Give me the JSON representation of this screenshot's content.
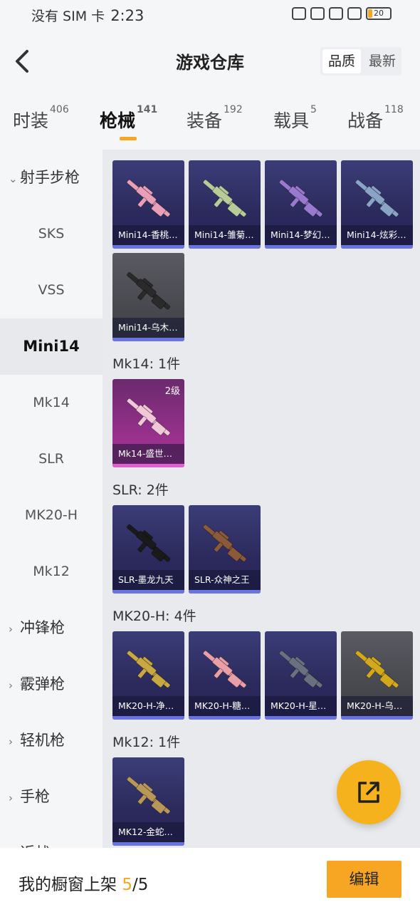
{
  "status_bar": {
    "carrier": "没有 SIM 卡",
    "time": "2:23",
    "battery": "20"
  },
  "header": {
    "title": "游戏仓库",
    "sort_options": [
      "品质",
      "最新"
    ]
  },
  "tabs": [
    {
      "label": "时装",
      "count": "406"
    },
    {
      "label": "枪械",
      "count": "141"
    },
    {
      "label": "装备",
      "count": "192"
    },
    {
      "label": "载具",
      "count": "5"
    },
    {
      "label": "战备",
      "count": "118"
    }
  ],
  "sidebar": {
    "items": [
      {
        "label": "射手步枪",
        "type": "category-open"
      },
      {
        "label": "SKS",
        "type": "sub"
      },
      {
        "label": "VSS",
        "type": "sub"
      },
      {
        "label": "Mini14",
        "type": "sub-active"
      },
      {
        "label": "Mk14",
        "type": "sub"
      },
      {
        "label": "SLR",
        "type": "sub"
      },
      {
        "label": "MK20-H",
        "type": "sub"
      },
      {
        "label": "Mk12",
        "type": "sub"
      },
      {
        "label": "冲锋枪",
        "type": "category"
      },
      {
        "label": "霰弹枪",
        "type": "category"
      },
      {
        "label": "轻机枪",
        "type": "category"
      },
      {
        "label": "手枪",
        "type": "category"
      },
      {
        "label": "近战",
        "type": "category"
      }
    ]
  },
  "sections": {
    "mini14": {
      "cards": [
        {
          "name": "Mini14-香桃…",
          "style": "purple",
          "gun_color": "#e8a0b8"
        },
        {
          "name": "Mini14-雏菊…",
          "style": "purple",
          "gun_color": "#b8cc9a"
        },
        {
          "name": "Mini14-梦幻…",
          "style": "purple",
          "gun_color": "#9a7ad0"
        },
        {
          "name": "Mini14-炫彩…",
          "style": "purple",
          "gun_color": "#8aa4c8"
        },
        {
          "name": "Mini14-乌木…",
          "style": "gray",
          "gun_color": "#2a2a2a"
        }
      ]
    },
    "mk14": {
      "heading": "Mk14: 1件",
      "cards": [
        {
          "name": "Mk14-盛世…",
          "style": "pink",
          "gun_color": "#f0c8d8",
          "level": "2级"
        }
      ]
    },
    "slr": {
      "heading": "SLR: 2件",
      "cards": [
        {
          "name": "SLR-墨龙九天",
          "style": "purple",
          "gun_color": "#1a1a1a"
        },
        {
          "name": "SLR-众神之王",
          "style": "purple",
          "gun_color": "#8a5a3a"
        }
      ]
    },
    "mk20h": {
      "heading": "MK20-H: 4件",
      "cards": [
        {
          "name": "MK20-H-净…",
          "style": "purple",
          "gun_color": "#c8a840"
        },
        {
          "name": "MK20-H-糖…",
          "style": "purple",
          "gun_color": "#e8a0a8"
        },
        {
          "name": "MK20-H-星…",
          "style": "purple",
          "gun_color": "#6a7080"
        },
        {
          "name": "MK20-H-乌…",
          "style": "gray",
          "gun_color": "#d4a81c"
        }
      ]
    },
    "mk12": {
      "heading": "Mk12: 1件",
      "cards": [
        {
          "name": "MK12-金蛇…",
          "style": "purple",
          "gun_color": "#b89858"
        }
      ]
    }
  },
  "bottom_bar": {
    "label": "我的橱窗上架",
    "current": "5",
    "total": "/5",
    "edit_label": "编辑"
  },
  "colors": {
    "accent": "#f6a623",
    "card_purple": "#2c2a5c",
    "card_gray": "#3d3e44",
    "card_pink": "#b0349c"
  }
}
